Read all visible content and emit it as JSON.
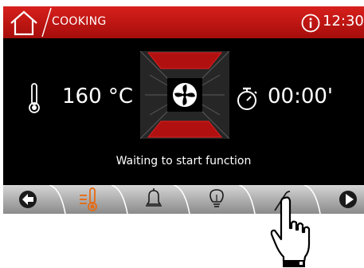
{
  "header": {
    "breadcrumb": "COOKING",
    "time": "12:30"
  },
  "main": {
    "temperature": "160 °C",
    "timer": "00:00'",
    "status_text": "Waiting to start function"
  },
  "bottom_bar": {
    "items": [
      {
        "icon": "back-arrow-icon"
      },
      {
        "icon": "temperature-icon",
        "active": true
      },
      {
        "icon": "bell-icon"
      },
      {
        "icon": "light-bulb-icon"
      },
      {
        "icon": "probe-icon"
      },
      {
        "icon": "play-icon"
      }
    ]
  },
  "colors": {
    "accent_red": "#c8140f",
    "active_orange": "#e86a10",
    "background": "#000000"
  }
}
